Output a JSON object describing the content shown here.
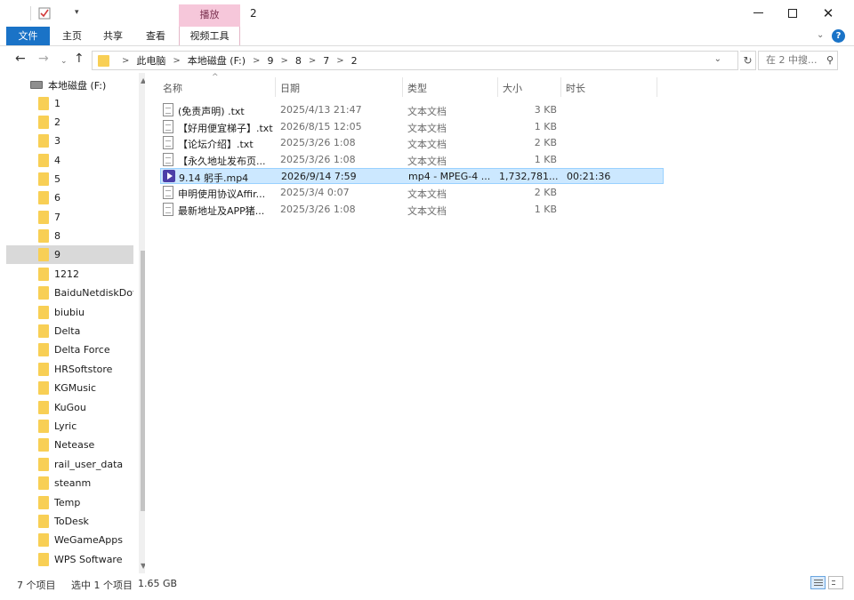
{
  "titlebar": {
    "context_tab": "播放",
    "title": "2",
    "dropdown_glyph": "▾",
    "min_label": "",
    "max_label": "",
    "close_label": "✕"
  },
  "ribbon": {
    "tabs": [
      "文件",
      "主页",
      "共享",
      "查看",
      "视频工具"
    ],
    "expand_glyph": "⌄",
    "help_glyph": "?"
  },
  "address": {
    "back_glyph": "←",
    "forward_glyph": "→",
    "recent_glyph": "⌄",
    "up_glyph": "↑",
    "crumbs": [
      "此电脑",
      "本地磁盘 (F:)",
      "9",
      "8",
      "7",
      "2"
    ],
    "separator": ">",
    "dropdown_glyph": "⌄",
    "refresh_glyph": "↻",
    "search_placeholder": "在 2 中搜...",
    "search_glyph": "⚲"
  },
  "navpane": {
    "drive": "本地磁盘 (F:)",
    "folders": [
      "1",
      "2",
      "3",
      "4",
      "5",
      "6",
      "7",
      "8",
      "9",
      "1212",
      "BaiduNetdiskDow",
      "biubiu",
      "Delta",
      "Delta Force",
      "HRSoftstore",
      "KGMusic",
      "KuGou",
      "Lyric",
      "Netease",
      "rail_user_data",
      "steanm",
      "Temp",
      "ToDesk",
      "WeGameApps",
      "WPS Software"
    ],
    "selected": "9",
    "scroll_up": "▲",
    "scroll_down": "▼"
  },
  "filelist": {
    "columns": [
      "名称",
      "日期",
      "类型",
      "大小",
      "时长"
    ],
    "sort_caret": "^",
    "rows": [
      {
        "name": "(免责声明) .txt",
        "date": "2025/4/13 21:47",
        "type": "文本文档",
        "size": "3 KB",
        "duration": "",
        "icon": "text-file-icon",
        "selected": false
      },
      {
        "name": "【好用便宜梯子】.txt",
        "date": "2026/8/15 12:05",
        "type": "文本文档",
        "size": "1 KB",
        "duration": "",
        "icon": "text-file-icon",
        "selected": false
      },
      {
        "name": "【论坛介绍】.txt",
        "date": "2025/3/26 1:08",
        "type": "文本文档",
        "size": "2 KB",
        "duration": "",
        "icon": "text-file-icon",
        "selected": false
      },
      {
        "name": "【永久地址发布页...",
        "date": "2025/3/26 1:08",
        "type": "文本文档",
        "size": "1 KB",
        "duration": "",
        "icon": "text-file-icon",
        "selected": false
      },
      {
        "name": "9.14 躬手.mp4",
        "date": "2026/9/14 7:59",
        "type": "mp4 - MPEG-4 ...",
        "size": "1,732,781...",
        "duration": "00:21:36",
        "icon": "video-file-icon",
        "selected": true
      },
      {
        "name": "申明使用协议Affir...",
        "date": "2025/3/4 0:07",
        "type": "文本文档",
        "size": "2 KB",
        "duration": "",
        "icon": "text-file-icon",
        "selected": false
      },
      {
        "name": "最新地址及APP猪...",
        "date": "2025/3/26 1:08",
        "type": "文本文档",
        "size": "1 KB",
        "duration": "",
        "icon": "text-file-icon",
        "selected": false
      }
    ]
  },
  "statusbar": {
    "item_count": "7 个项目",
    "selected_count": "选中 1 个项目",
    "selected_size": "1.65 GB"
  },
  "colors": {
    "accent": "#1a73c7",
    "context_tab": "#f6c7da",
    "selection": "#cce8ff",
    "folder": "#f8cf55"
  }
}
